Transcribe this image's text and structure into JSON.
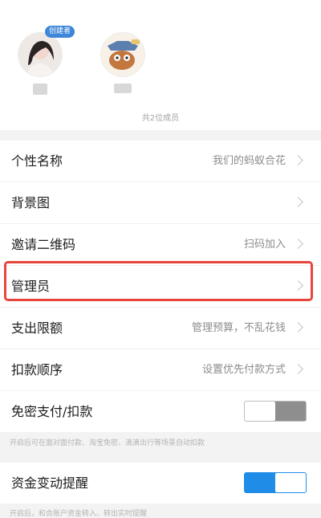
{
  "members": {
    "creator_badge": "创建者",
    "count_text": "共2位成员"
  },
  "settings": {
    "nickname": {
      "label": "个性名称",
      "value": "我们的蚂蚁合花"
    },
    "background": {
      "label": "背景图"
    },
    "invite_qr": {
      "label": "邀请二维码",
      "value": "扫码加入"
    },
    "admin": {
      "label": "管理员"
    },
    "spend_limit": {
      "label": "支出限额",
      "value": "管理预算，不乱花钱"
    },
    "deduction_order": {
      "label": "扣款顺序",
      "value": "设置优先付款方式"
    },
    "password_free": {
      "label": "免密支付/扣款",
      "enabled": false
    }
  },
  "hint_password_free": "开启后可在面对面付款、淘宝免密、滴滴出行等场景自动扣款",
  "fund_alert": {
    "label": "资金变动提醒",
    "enabled": true
  },
  "hint_fund_alert": "开启后，和合账户资金转入、转出实时提醒",
  "colors": {
    "highlight": "#e8463d",
    "toggle_on": "#1f8de8",
    "badge": "#3d86d8"
  }
}
